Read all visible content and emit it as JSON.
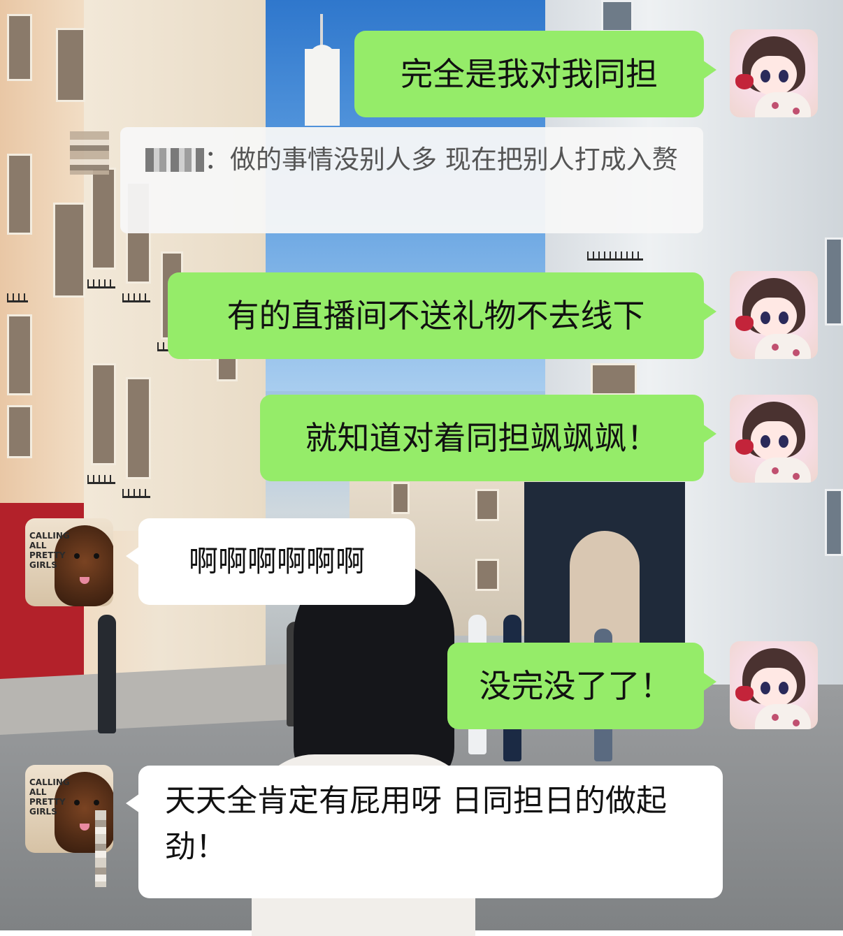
{
  "chat": {
    "messages": [
      {
        "sender": "me",
        "text": "完全是我对我同担"
      },
      {
        "sender": "quote",
        "name_redacted": true,
        "separator": "：",
        "text": "做的事情没别人多 现在把别人打成入赘"
      },
      {
        "sender": "me",
        "text": "有的直播间不送礼物不去线下"
      },
      {
        "sender": "me",
        "text": "就知道对着同担飒飒飒！"
      },
      {
        "sender": "other",
        "text": "啊啊啊啊啊啊"
      },
      {
        "sender": "me",
        "text": "没完没了了！"
      },
      {
        "sender": "other",
        "text": "天天全肯定有屁用呀 日同担日的做起劲！"
      }
    ]
  },
  "avatars": {
    "me": {
      "icon": "doll-avatar-icon"
    },
    "other": {
      "icon": "dog-avatar-icon",
      "caption": "CALLING ALL PRETTY GIRLS"
    }
  },
  "colors": {
    "me_bubble": "#95ec69",
    "other_bubble": "#ffffff",
    "quote_bg": "#f7f7f7",
    "quote_text": "#555555"
  }
}
